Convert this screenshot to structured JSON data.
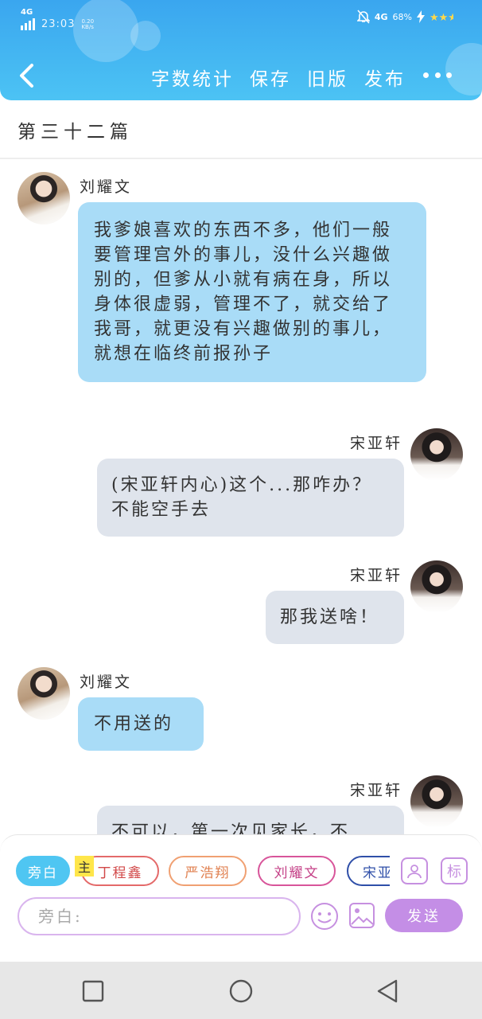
{
  "status_bar": {
    "signal_label": "4G",
    "time": "23:03",
    "net_speed": "0.20 KB/s",
    "net_label_right": "4G",
    "battery_percent": "68%"
  },
  "nav": {
    "actions": [
      "字数统计",
      "保存",
      "旧版",
      "发布"
    ]
  },
  "chapter_title": "第三十二篇",
  "messages": [
    {
      "speaker": "刘耀文",
      "side": "left",
      "text": "我爹娘喜欢的东西不多，他们一般要管理宫外的事儿，没什么兴趣做别的，但爹从小就有病在身，所以身体很虚弱，管理不了，就交给了我哥，就更没有兴趣做别的事儿，就想在临终前报孙子"
    },
    {
      "speaker": "宋亚轩",
      "side": "right",
      "text": "(宋亚轩内心)这个...那咋办？不能空手去"
    },
    {
      "speaker": "宋亚轩",
      "side": "right",
      "text": "那我送啥！"
    },
    {
      "speaker": "刘耀文",
      "side": "left",
      "text": "不用送的"
    },
    {
      "speaker": "宋亚轩",
      "side": "right",
      "text": "不可以，第一次见家长，不"
    }
  ],
  "composer": {
    "chips": [
      "旁白",
      "丁程鑫",
      "严浩翔",
      "刘耀文",
      "宋亚轩"
    ],
    "main_tag": "主",
    "mark_button": "标",
    "input_placeholder": "旁白:",
    "send_label": "发送"
  },
  "colors": {
    "header_blue": "#3aa6ef",
    "bubble_left": "#a9dcf7",
    "bubble_right": "#dfe4ec",
    "accent_purple": "#c48ee6",
    "chip_dingchengxin": "#e46a6a",
    "chip_yanhaoxiang": "#f0a072",
    "chip_liuyaowen": "#d8559a",
    "chip_songyaxuan": "#2f4fa8"
  }
}
